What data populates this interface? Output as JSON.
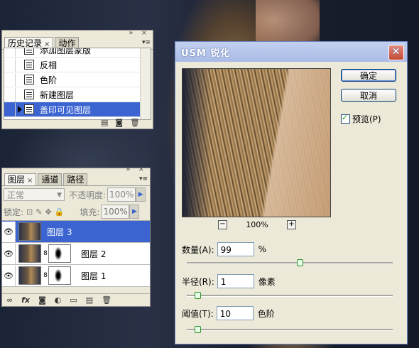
{
  "history_panel": {
    "tabs": [
      {
        "label": "历史记录"
      },
      {
        "label": "动作"
      }
    ],
    "items": [
      {
        "label": "添加图层蒙版"
      },
      {
        "label": "反相"
      },
      {
        "label": "色阶"
      },
      {
        "label": "新建图层"
      },
      {
        "label": "盖印可见图层",
        "selected": true
      }
    ]
  },
  "layers_panel": {
    "tabs": [
      {
        "label": "图层"
      },
      {
        "label": "通道"
      },
      {
        "label": "路径"
      }
    ],
    "blend_mode": "正常",
    "opacity_label": "不透明度:",
    "opacity_value": "100%",
    "lock_label": "锁定:",
    "fill_label": "填充:",
    "fill_value": "100%",
    "layers": [
      {
        "name": "图层 3",
        "selected": true
      },
      {
        "name": "图层 2"
      },
      {
        "name": "图层 1"
      }
    ]
  },
  "dialog": {
    "title": "USM 锐化",
    "ok_label": "确定",
    "cancel_label": "取消",
    "preview_label": "预览(P)",
    "preview_checked": true,
    "zoom": "100%",
    "amount": {
      "label": "数量(A):",
      "value": "99",
      "unit": "%",
      "slider_fraction": 0.55
    },
    "radius": {
      "label": "半径(R):",
      "value": "1",
      "unit": "像素",
      "slider_fraction": 0.04
    },
    "threshold": {
      "label": "阈值(T):",
      "value": "10",
      "unit": "色阶",
      "slider_fraction": 0.04
    }
  }
}
